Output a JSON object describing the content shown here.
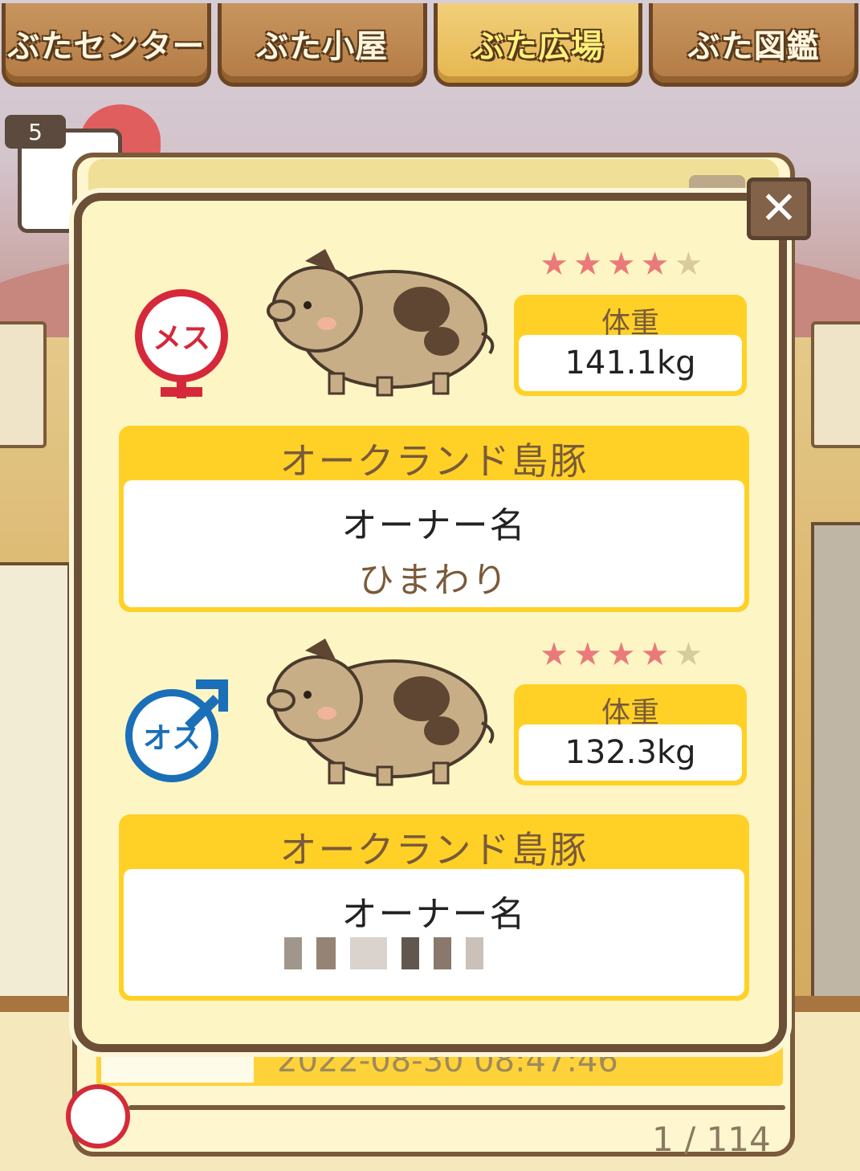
{
  "tabs": [
    {
      "label": "ぶたセンター",
      "active": false
    },
    {
      "label": "ぶた小屋",
      "active": false
    },
    {
      "label": "ぶた広場",
      "active": true
    },
    {
      "label": "ぶた図鑑",
      "active": false
    }
  ],
  "queue": {
    "count": "5"
  },
  "background_list": {
    "timestamp": "2022-08-30 08:47:46",
    "pager": "1 / 114"
  },
  "dialog": {
    "close_glyph": "✕",
    "pigs": [
      {
        "gender_label": "メス",
        "gender": "female",
        "stars": {
          "filled": 4,
          "total": 5
        },
        "weight_label": "体重",
        "weight_value": "141.1kg",
        "breed": "オークランド島豚",
        "owner_label": "オーナー名",
        "owner_value": "ひまわり"
      },
      {
        "gender_label": "オス",
        "gender": "male",
        "stars": {
          "filled": 4,
          "total": 5
        },
        "weight_label": "体重",
        "weight_value": "132.3kg",
        "breed": "オークランド島豚",
        "owner_label": "オーナー名",
        "owner_value": ""
      }
    ]
  },
  "colors": {
    "female": "#d6283b",
    "male": "#1a6fb8",
    "panel_yellow": "#ffd126",
    "frame_brown": "#6b4f36"
  }
}
